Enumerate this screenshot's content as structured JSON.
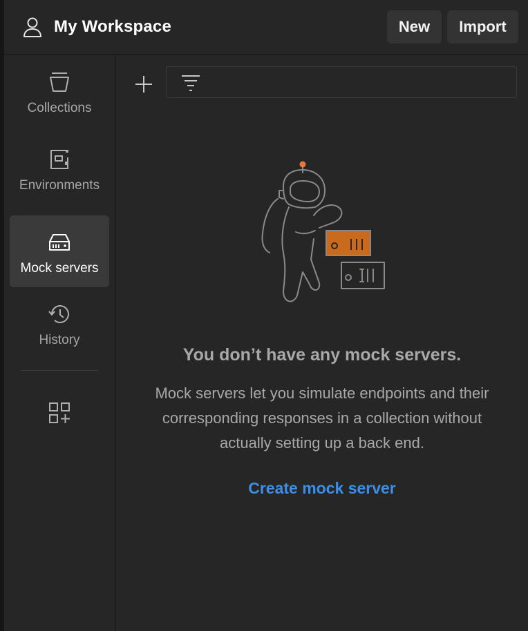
{
  "header": {
    "workspace_title": "My Workspace",
    "new_label": "New",
    "import_label": "Import"
  },
  "sidebar": {
    "items": [
      {
        "label": "Collections",
        "icon": "collections-icon"
      },
      {
        "label": "Environments",
        "icon": "environments-icon"
      },
      {
        "label": "Mock servers",
        "icon": "mock-server-icon",
        "active": true
      },
      {
        "label": "History",
        "icon": "history-icon"
      }
    ],
    "extra_icon": "apps-add-icon"
  },
  "toolbar": {
    "add_icon": "plus-icon",
    "filter_icon": "filter-icon",
    "filter_placeholder": ""
  },
  "empty_state": {
    "title": "You don’t have any mock servers.",
    "description": "Mock servers let you simulate endpoints and their corresponding responses in a collection without actually setting up a back end.",
    "action_label": "Create mock server"
  },
  "colors": {
    "background": "#262626",
    "active_nav": "#3a3a3a",
    "link": "#3d8ee6",
    "illustration_accent": "#d2691e"
  }
}
